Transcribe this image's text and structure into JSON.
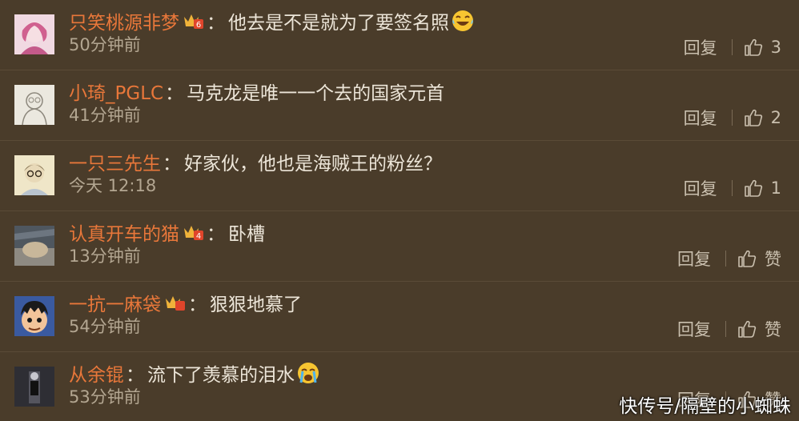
{
  "comments": [
    {
      "name": "只笑桃源非梦",
      "vip": true,
      "vip_level": "6",
      "text": "他去是不是就为了要签名照",
      "emoji": "laughing-tears",
      "time": "50分钟前",
      "reply": "回复",
      "likes": "3",
      "avatar_colors": [
        "#d9a6b8",
        "#c45a8a",
        "#f3d7e0"
      ]
    },
    {
      "name": "小琦_PGLC",
      "vip": false,
      "vip_level": "",
      "text": "马克龙是唯一一个去的国家元首",
      "emoji": "",
      "time": "41分钟前",
      "reply": "回复",
      "likes": "2",
      "avatar_colors": [
        "#e9e6dc",
        "#9a958a",
        "#d8d3c6"
      ]
    },
    {
      "name": "一只三先生",
      "vip": false,
      "vip_level": "",
      "text": "好家伙，他也是海贼王的粉丝？",
      "emoji": "",
      "time": "今天 12:18",
      "reply": "回复",
      "likes": "1",
      "avatar_colors": [
        "#d9cda8",
        "#8a7550",
        "#efe6c8"
      ]
    },
    {
      "name": "认真开车的猫",
      "vip": true,
      "vip_level": "4",
      "text": "卧槽",
      "emoji": "",
      "time": "13分钟前",
      "reply": "回复",
      "likes": "赞",
      "avatar_colors": [
        "#5d6670",
        "#a9b0b5",
        "#3a3f44"
      ]
    },
    {
      "name": "一抗一麻袋",
      "vip": true,
      "vip_level": "",
      "text": "狠狠地慕了",
      "emoji": "",
      "time": "54分钟前",
      "reply": "回复",
      "likes": "赞",
      "avatar_colors": [
        "#2c3f7a",
        "#f2c49a",
        "#1a1a1a"
      ]
    },
    {
      "name": "从余锟",
      "vip": false,
      "vip_level": "",
      "text": "流下了羡慕的泪水",
      "emoji": "crying",
      "time": "53分钟前",
      "reply": "回复",
      "likes": "赞",
      "avatar_colors": [
        "#2a2a30",
        "#8a8a95",
        "#c8c8cf"
      ]
    }
  ],
  "watermark": "快传号/隔壁的小蜘蛛",
  "colors": {
    "background": "#4a3c2a",
    "name": "#e8773a",
    "text": "#ece5d8",
    "meta": "#b3a691"
  }
}
